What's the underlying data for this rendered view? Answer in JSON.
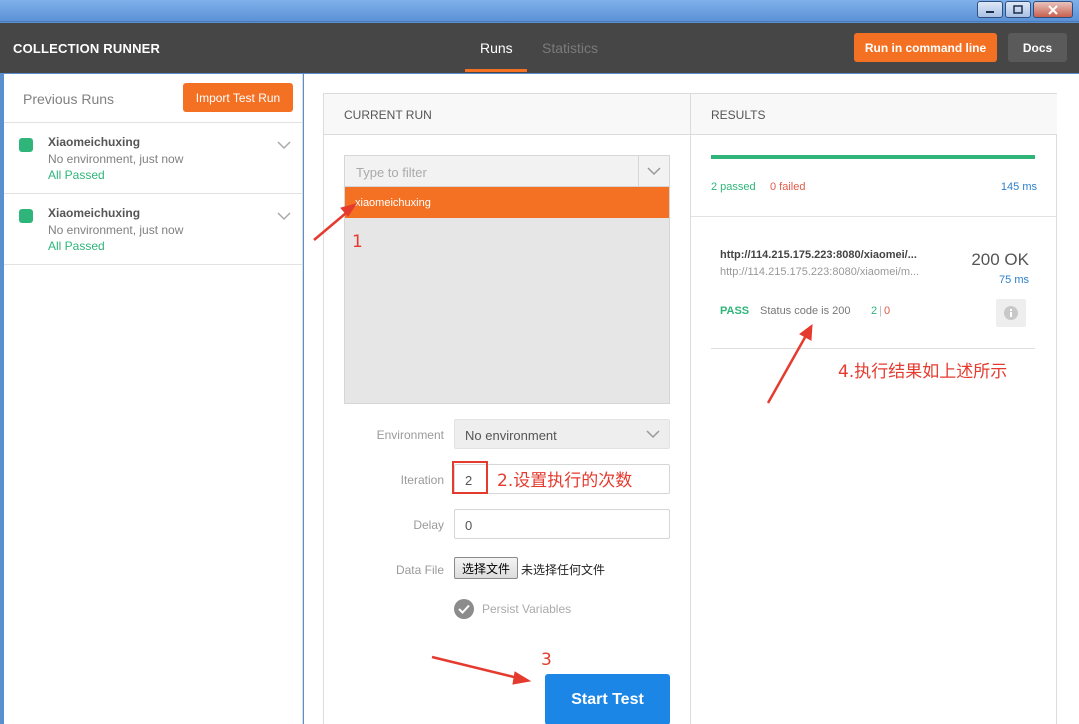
{
  "window": {
    "controls": [
      "minimize-icon",
      "maximize-icon",
      "close-icon"
    ]
  },
  "header": {
    "title": "COLLECTION RUNNER",
    "tabs": [
      {
        "label": "Runs",
        "active": true
      },
      {
        "label": "Statistics",
        "active": false
      }
    ],
    "run_cmd_label": "Run in command line",
    "docs_label": "Docs"
  },
  "sidebar": {
    "title": "Previous Runs",
    "import_label": "Import Test Run",
    "runs": [
      {
        "name": "Xiaomeichuxing",
        "env": "No environment, just now",
        "status": "All Passed"
      },
      {
        "name": "Xiaomeichuxing",
        "env": "No environment, just now",
        "status": "All Passed"
      }
    ]
  },
  "current_run": {
    "heading": "CURRENT RUN",
    "filter_placeholder": "Type to filter",
    "selected_collection": "xiaomeichuxing",
    "environment_label": "Environment",
    "environment_value": "No environment",
    "iteration_label": "Iteration",
    "iteration_value": "2",
    "delay_label": "Delay",
    "delay_value": "0",
    "datafile_label": "Data File",
    "datafile_button": "选择文件",
    "datafile_status": "未选择任何文件",
    "persist_label": "Persist Variables",
    "start_label": "Start Test"
  },
  "results": {
    "heading": "RESULTS",
    "passed": "2 passed",
    "failed": "0 failed",
    "total_time": "145 ms",
    "request": {
      "url": "http://114.215.175.223:8080/xiaomei/...",
      "url_full": "http://114.215.175.223:8080/xiaomei/m...",
      "status": "200 OK",
      "time": "75 ms",
      "test_result": "PASS",
      "test_name": "Status code is 200",
      "pass_count": "2",
      "fail_count": "0"
    }
  },
  "annotations": {
    "a1": "1",
    "a2": "2.设置执行的次数",
    "a3": "3",
    "a4": "4.执行结果如上述所示"
  },
  "colors": {
    "accent": "#f47023",
    "success": "#2fb57a",
    "failure": "#e05a4a",
    "link": "#2b7fc9",
    "primary_button": "#1b86e6",
    "annotation": "#e53b2f"
  }
}
